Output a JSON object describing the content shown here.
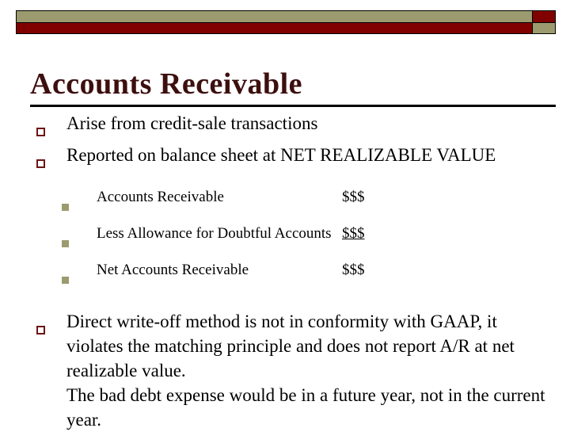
{
  "slide": {
    "title": "Accounts Receivable",
    "banner": {
      "top_left_color": "#9b9b6f",
      "top_right_color": "#800000",
      "bottom_left_color": "#800000",
      "bottom_right_color": "#9b9b6f",
      "border_color": "#000000"
    },
    "theme": {
      "title_color": "#3d0f0f",
      "bullet_level1_color": "#6b1414",
      "bullet_level2_color": "#9b9b6f",
      "text_color": "#000000",
      "background_color": "#ffffff"
    },
    "bullets": [
      {
        "level": 1,
        "bullet_icon": "hollow-square-bullet-icon",
        "text": "Arise from credit-sale transactions"
      },
      {
        "level": 1,
        "bullet_icon": "hollow-square-bullet-icon",
        "text": "Reported on balance sheet at NET REALIZABLE VALUE"
      }
    ],
    "sub_bullets": [
      {
        "level": 2,
        "bullet_icon": "solid-square-bullet-icon",
        "label": "Accounts Receivable",
        "amount": "$$$",
        "underlined": false
      },
      {
        "level": 2,
        "bullet_icon": "solid-square-bullet-icon",
        "label": "Less Allowance for Doubtful Accounts",
        "amount": "$$$",
        "underlined": true
      },
      {
        "level": 2,
        "bullet_icon": "solid-square-bullet-icon",
        "label": "Net Accounts Receivable",
        "amount": "$$$",
        "underlined": false
      }
    ],
    "closing_bullet": {
      "level": 1,
      "bullet_icon": "hollow-square-bullet-icon",
      "paragraph_1": "Direct write-off method is not in conformity with GAAP, it violates the matching principle and does not report A/R at net realizable value.",
      "paragraph_2": "The bad debt expense would be in a future year, not in the current year."
    }
  }
}
